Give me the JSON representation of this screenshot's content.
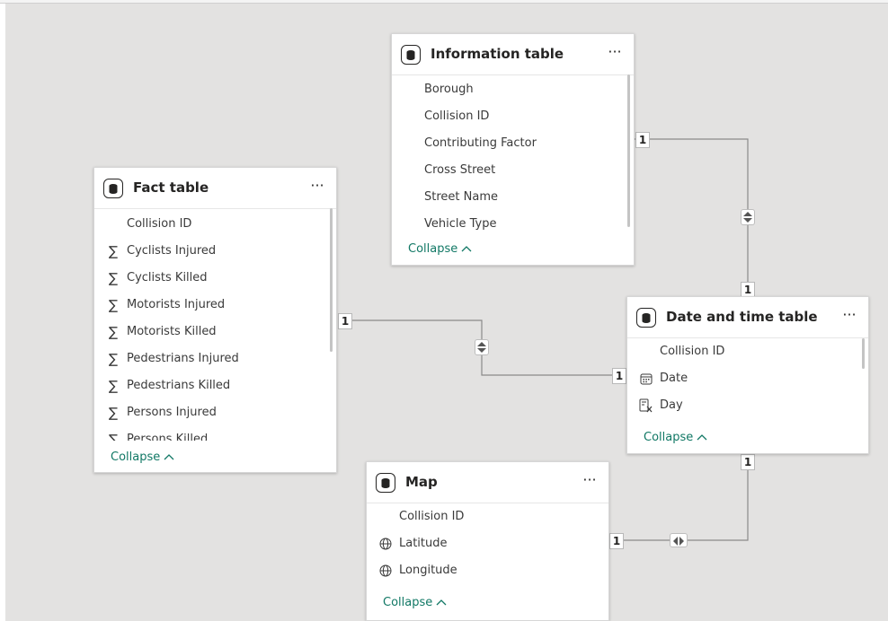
{
  "tables": {
    "information": {
      "title": "Information table",
      "fields": [
        "Borough",
        "Collision ID",
        "Contributing Factor",
        "Cross Street",
        "Street Name",
        "Vehicle Type"
      ],
      "collapse_label": "Collapse"
    },
    "fact": {
      "title": "Fact table",
      "fields": [
        {
          "icon": "",
          "label": "Collision ID"
        },
        {
          "icon": "∑",
          "label": "Cyclists Injured"
        },
        {
          "icon": "∑",
          "label": "Cyclists Killed"
        },
        {
          "icon": "∑",
          "label": "Motorists Injured"
        },
        {
          "icon": "∑",
          "label": "Motorists Killed"
        },
        {
          "icon": "∑",
          "label": "Pedestrians Injured"
        },
        {
          "icon": "∑",
          "label": "Pedestrians Killed"
        },
        {
          "icon": "∑",
          "label": "Persons Injured"
        },
        {
          "icon": "∑",
          "label": "Persons Killed"
        }
      ],
      "collapse_label": "Collapse"
    },
    "datetime": {
      "title": "Date and time table",
      "fields": [
        {
          "icon": "",
          "label": "Collision ID"
        },
        {
          "icon": "calendar",
          "label": "Date"
        },
        {
          "icon": "calculated",
          "label": "Day"
        }
      ],
      "collapse_label": "Collapse"
    },
    "map": {
      "title": "Map",
      "fields": [
        {
          "icon": "",
          "label": "Collision ID"
        },
        {
          "icon": "globe",
          "label": "Latitude"
        },
        {
          "icon": "globe",
          "label": "Longitude"
        }
      ],
      "collapse_label": "Collapse"
    }
  },
  "relationships": {
    "fact_datetime": {
      "from_label": "1",
      "to_label": "1",
      "direction": "both"
    },
    "information_datetime": {
      "from_label": "1",
      "to_label": "1",
      "direction": "both"
    },
    "map_datetime": {
      "from_label": "1",
      "to_label": "1",
      "direction": "both"
    }
  },
  "colors": {
    "canvas": "#e3e2e1",
    "accent": "#117865",
    "line": "#8a8a8a"
  }
}
